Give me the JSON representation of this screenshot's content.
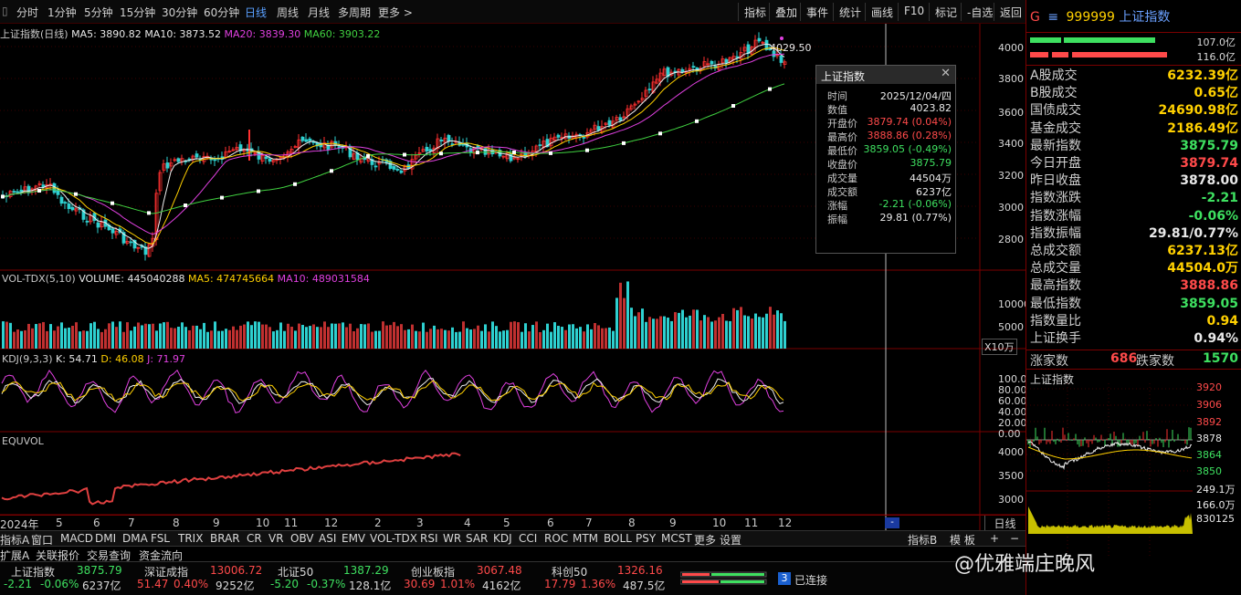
{
  "toolbar": {
    "periods": [
      "分时",
      "1分钟",
      "5分钟",
      "15分钟",
      "30分钟",
      "60分钟",
      "日线",
      "周线",
      "月线",
      "多周期",
      "更多 >"
    ],
    "active_period": "日线",
    "buttons": [
      "指标",
      "叠加",
      "事件",
      "统计",
      "画线",
      "F10",
      "标记",
      "-自选",
      "返回"
    ]
  },
  "header": {
    "title": "上证指数(日线)",
    "ma5": "MA5: 3890.82",
    "ma10": "MA10: 3873.52",
    "ma20": "MA20: 3839.30",
    "ma60": "MA60: 3903.22",
    "peak_label": "4029.50"
  },
  "main_axis": [
    "4000",
    "3800",
    "3600",
    "3400",
    "3200",
    "3000",
    "2800"
  ],
  "vol": {
    "title": "VOL-TDX(5,10)",
    "volume": "VOLUME: 445040288",
    "ma5": "MA5: 474745664",
    "ma10": "MA10: 489031584",
    "axis": [
      "10000",
      "5000"
    ],
    "unit": "X10万"
  },
  "kdj": {
    "title": "KDJ(9,3,3)",
    "k": "K: 54.71",
    "d": "D: 46.08",
    "j": "J: 71.97",
    "axis": [
      "100.00",
      "80.00",
      "60.00",
      "40.00",
      "20.00",
      "0.00"
    ]
  },
  "equvol": {
    "title": "EQUVOL",
    "axis": [
      "4000",
      "3500",
      "3000"
    ]
  },
  "dates": [
    "2024年",
    "5",
    "6",
    "7",
    "8",
    "9",
    "10",
    "11",
    "12",
    "2",
    "3",
    "4",
    "5",
    "6",
    "7",
    "8",
    "9",
    "10",
    "11",
    "12"
  ],
  "date_btn": "日线",
  "tooltip": {
    "title": "上证指数",
    "rows": [
      {
        "k": "时间",
        "v": "2025/12/04/四",
        "c": "#e8e8e8"
      },
      {
        "k": "数值",
        "v": "4023.82",
        "c": "#e8e8e8"
      },
      {
        "k": "开盘价",
        "v": "3879.74 (0.04%)",
        "c": "#ff4a4a"
      },
      {
        "k": "最高价",
        "v": "3888.86 (0.28%)",
        "c": "#ff4a4a"
      },
      {
        "k": "最低价",
        "v": "3859.05 (-0.49%)",
        "c": "#3ee060"
      },
      {
        "k": "收盘价",
        "v": "3875.79",
        "c": "#3ee060"
      },
      {
        "k": "成交量",
        "v": "44504万",
        "c": "#e8e8e8"
      },
      {
        "k": "成交额",
        "v": "6237亿",
        "c": "#e8e8e8"
      },
      {
        "k": "涨幅",
        "v": "-2.21 (-0.06%)",
        "c": "#3ee060"
      },
      {
        "k": "振幅",
        "v": "29.81 (0.77%)",
        "c": "#e8e8e8"
      }
    ]
  },
  "indicator_tabs": [
    "指标A",
    "窗口",
    "MACD",
    "DMI",
    "DMA",
    "FSL",
    "TRIX",
    "BRAR",
    "CR",
    "VR",
    "OBV",
    "ASI",
    "EMV",
    "VOL-TDX",
    "RSI",
    "WR",
    "SAR",
    "KDJ",
    "CCI",
    "ROC",
    "MTM",
    "BOLL",
    "PSY",
    "MCST",
    "更多",
    "设置"
  ],
  "indicator_b": [
    "指标B",
    "模 板",
    "+",
    "−"
  ],
  "bottom_tabs": [
    "扩展A",
    "关联报价",
    "交易查询",
    "资金流向"
  ],
  "status": [
    {
      "name": "上证指数",
      "val": "3875.79",
      "chg": "-2.21",
      "pct": "-0.06%",
      "amt": "6237亿",
      "c": "#3ee060"
    },
    {
      "name": "深证成指",
      "val": "13006.72",
      "chg": "51.47",
      "pct": "0.40%",
      "amt": "9252亿",
      "c": "#ff4a4a"
    },
    {
      "name": "北证50",
      "val": "1387.29",
      "chg": "-5.20",
      "pct": "-0.37%",
      "amt": "128.1亿",
      "c": "#3ee060"
    },
    {
      "name": "创业板指",
      "val": "3067.48",
      "chg": "30.69",
      "pct": "1.01%",
      "amt": "4162亿",
      "c": "#ff4a4a"
    },
    {
      "name": "科创50",
      "val": "1326.16",
      "chg": "17.79",
      "pct": "1.36%",
      "amt": "487.5亿",
      "c": "#ff4a4a"
    }
  ],
  "connection": {
    "count": "3",
    "label": "已连接"
  },
  "watermark": "@优雅端庄晚风",
  "right": {
    "code": "999999",
    "name": "上证指数",
    "prefix": "G",
    "bar_vals": [
      "107.0亿",
      "116.0亿"
    ],
    "rows": [
      {
        "k": "A股成交",
        "v": "6232.39亿",
        "c": "#ffd000"
      },
      {
        "k": "B股成交",
        "v": "0.65亿",
        "c": "#ffd000"
      },
      {
        "k": "国债成交",
        "v": "24690.98亿",
        "c": "#ffd000"
      },
      {
        "k": "基金成交",
        "v": "2186.49亿",
        "c": "#ffd000"
      },
      {
        "k": "最新指数",
        "v": "3875.79",
        "c": "#3ee060"
      },
      {
        "k": "今日开盘",
        "v": "3879.74",
        "c": "#ff4a4a"
      },
      {
        "k": "昨日收盘",
        "v": "3878.00",
        "c": "#e8e8e8"
      },
      {
        "k": "指数涨跌",
        "v": "-2.21",
        "c": "#3ee060"
      },
      {
        "k": "指数涨幅",
        "v": "-0.06%",
        "c": "#3ee060"
      },
      {
        "k": "指数振幅",
        "v": "29.81/0.77%",
        "c": "#e8e8e8"
      },
      {
        "k": "总成交额",
        "v": "6237.13亿",
        "c": "#ffd000"
      },
      {
        "k": "总成交量",
        "v": "44504.0万",
        "c": "#ffd000"
      },
      {
        "k": "最高指数",
        "v": "3888.86",
        "c": "#ff4a4a"
      },
      {
        "k": "最低指数",
        "v": "3859.05",
        "c": "#3ee060"
      },
      {
        "k": "指数量比",
        "v": "0.94",
        "c": "#ffd000"
      },
      {
        "k": "上证换手",
        "v": "0.94%",
        "c": "#e8e8e8"
      }
    ],
    "breadth": {
      "up_label": "涨家数",
      "up": "686",
      "down_label": "跌家数",
      "down": "1570"
    },
    "mini_title": "上证指数",
    "mini_axis": [
      "3920",
      "3906",
      "3892",
      "3878",
      "3864",
      "3850"
    ],
    "mini_vol_axis": [
      "249.1万",
      "166.0万",
      "830125"
    ]
  }
}
